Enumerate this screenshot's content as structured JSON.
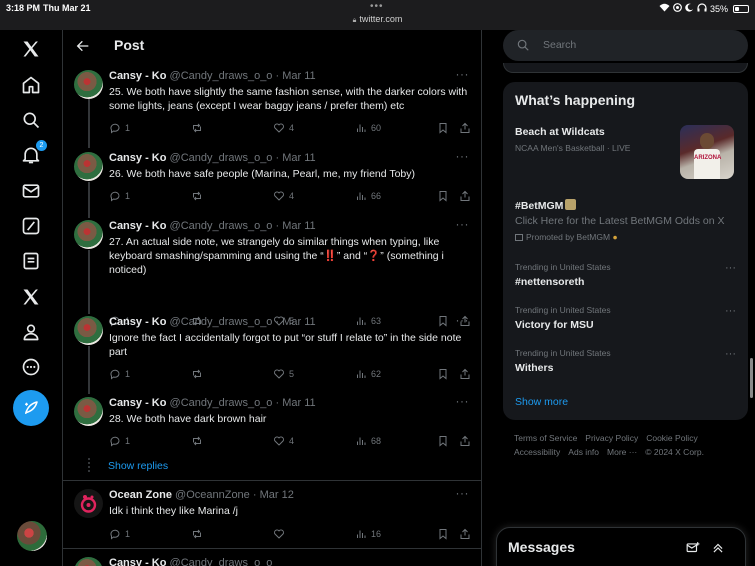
{
  "status_bar": {
    "time": "3:18 PM",
    "date": "Thu Mar 21",
    "dots": "•••",
    "url": "twitter.com",
    "battery": "35%",
    "battery_level": 0.35
  },
  "nav": {
    "notifications_badge": "2",
    "icons": [
      "x-logo-icon",
      "home-icon",
      "search-icon",
      "bell-icon",
      "mail-icon",
      "grok-icon",
      "lists-icon",
      "x-premium-icon",
      "profile-icon",
      "more-icon",
      "post-compose-icon"
    ]
  },
  "header": {
    "title": "Post"
  },
  "tweets": [
    {
      "name": "Cansy - Ko",
      "handle": "@Candy_draws_o_o",
      "date": "Mar 11",
      "text": "25. We both have slightly the same fashion sense, with the darker colors with some lights, jeans (except I wear baggy jeans / prefer them) etc",
      "replies": "1",
      "reposts": "",
      "likes": "4",
      "views": "60"
    },
    {
      "name": "Cansy - Ko",
      "handle": "@Candy_draws_o_o",
      "date": "Mar 11",
      "text": "26. We both have safe people (Marina, Pearl, me, my friend Toby)",
      "replies": "1",
      "reposts": "",
      "likes": "4",
      "views": "66"
    },
    {
      "name": "Cansy - Ko",
      "handle": "@Candy_draws_o_o",
      "date": "Mar 11",
      "text": "27. An actual side note, we strangely do similar things when typing, like keyboard smashing/spamming and using the “‼️” and “❓” (something i noticed)",
      "replies": "1",
      "reposts": "",
      "likes": "5",
      "views": "63"
    },
    {
      "name": "Cansy - Ko",
      "handle": "@Candy_draws_o_o",
      "date": "Mar 11",
      "text": "Ignore the fact I accidentally forgot to put “or stuff I relate to” in the side note part",
      "replies": "1",
      "reposts": "",
      "likes": "5",
      "views": "62"
    },
    {
      "name": "Cansy - Ko",
      "handle": "@Candy_draws_o_o",
      "date": "Mar 11",
      "text": "28. We both have dark brown hair",
      "replies": "1",
      "reposts": "",
      "likes": "4",
      "views": "68"
    },
    {
      "name": "Ocean Zone",
      "handle": "@OceannZone",
      "date": "Mar 12",
      "text": "Idk i think they like Marina /j",
      "replies": "1",
      "reposts": "",
      "likes": "",
      "views": "16"
    }
  ],
  "next_tweet": {
    "name": "Cansy - Ko",
    "handle": "@Candy_draws_o_o"
  },
  "show_replies": "Show replies",
  "dot_sep": "·",
  "right": {
    "search_placeholder": "Search",
    "whats_happening": "What’s happening",
    "trend_1": {
      "title": "Beach at Wildcats",
      "meta": "NCAA Men's Basketball · LIVE"
    },
    "promo": {
      "title": "#BetMGM",
      "desc": "Click Here for the Latest BetMGM Odds on X",
      "meta": "Promoted by BetMGM"
    },
    "trend_2": {
      "meta": "Trending in United States",
      "title": "#nettensoreth"
    },
    "trend_3": {
      "meta": "Trending in United States",
      "title": "Victory for MSU"
    },
    "trend_4": {
      "meta": "Trending in United States",
      "title": "Withers"
    },
    "show_more": "Show more",
    "footer": {
      "terms": "Terms of Service",
      "privacy": "Privacy Policy",
      "cookie": "Cookie Policy",
      "accessibility": "Accessibility",
      "ads": "Ads info",
      "more": "More ···",
      "copyright": "© 2024 X Corp."
    },
    "thumb_jersey": "ARIZONA"
  },
  "messages": {
    "label": "Messages"
  },
  "colors": {
    "accent": "#1d9bf0",
    "background": "#000000",
    "text": "#e7e9ea",
    "muted": "#71767b"
  }
}
